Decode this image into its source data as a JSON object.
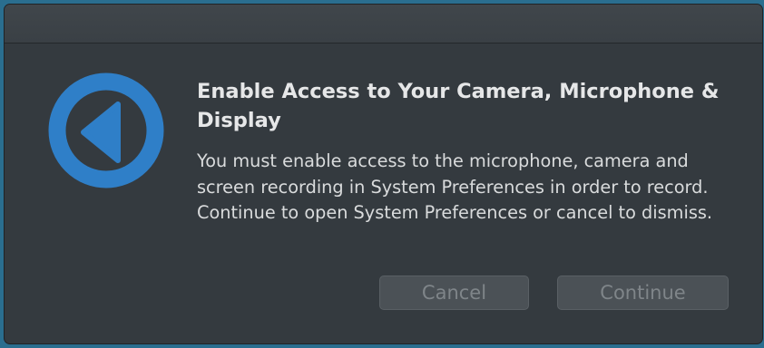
{
  "dialog": {
    "headline": "Enable Access to Your Camera, Microphone & Display",
    "message": "You must enable access to the microphone, camera and screen recording in System Preferences in order to record. Continue to open System Preferences or cancel to dismiss.",
    "icon": "back-arrow-circle-icon",
    "accent_color": "#2f7fc8"
  },
  "buttons": {
    "cancel_label": "Cancel",
    "continue_label": "Continue"
  }
}
